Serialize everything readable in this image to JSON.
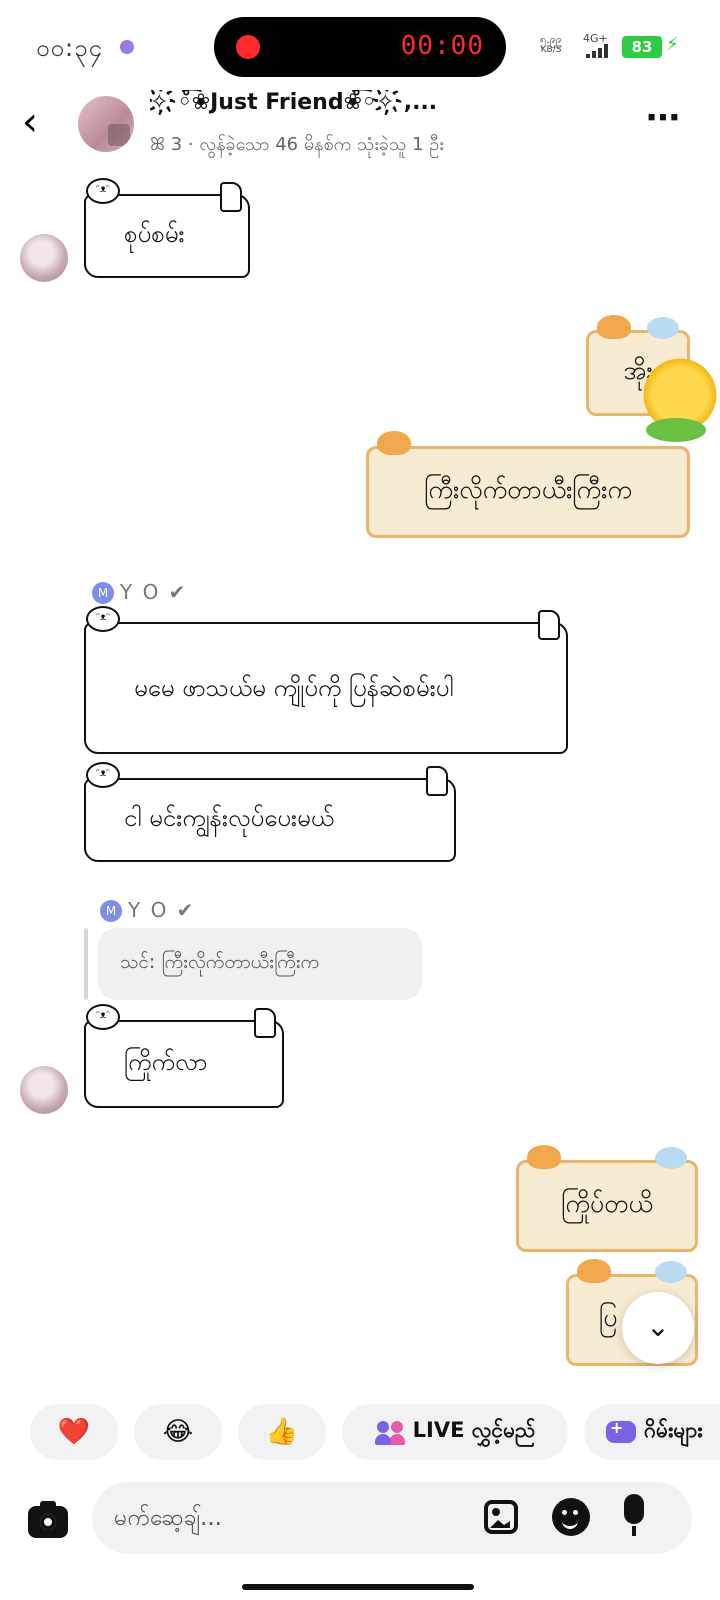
{
  "status_bar": {
    "time": "၀၀:၃၄",
    "recording_time": "00:00",
    "net_speed_value": "၅.၉၉",
    "net_speed_unit": "KB/S",
    "network": "4G+",
    "battery": "83"
  },
  "header": {
    "title": "✧҉◦̊͡❀Just Friend❀̊͡◦✧҉,...",
    "subtitle": "ꕤ 3 · လွန်ခဲ့သော 46 မိနစ်က သုံးခဲ့သူ 1 ဦး"
  },
  "messages": [
    {
      "side": "left",
      "style": "scroll",
      "text": "စုပ်စမ်း"
    },
    {
      "side": "right",
      "style": "cat",
      "text": "အိုး"
    },
    {
      "side": "right",
      "style": "cat",
      "text": "ကြီးလိုက်တာယီးကြီးက"
    },
    {
      "side": "left",
      "style": "scroll",
      "sender": "Y O ✔",
      "text": "မမေ ဖာသယ်မ ကျိုပ်ကို ပြန်ဆဲစမ်းပါ"
    },
    {
      "side": "left",
      "style": "scroll",
      "text": "ငါ မင်းကျွန်းလုပ်ပေးမယ်"
    },
    {
      "side": "left",
      "style": "scroll",
      "sender": "Y O ✔",
      "reply_to": "သင်: ကြီးလိုက်တာယီးကြီးက",
      "text": "ကြိုက်လာ"
    },
    {
      "side": "right",
      "style": "cat",
      "text": "ကြိုပ်တယိ"
    },
    {
      "side": "right",
      "style": "cat",
      "text": "ပြ"
    }
  ],
  "sender_initial": "M",
  "quick_actions": {
    "heart": "❤️",
    "laugh": "😂",
    "thumbs": "👍",
    "live_label": "LIVE လွှင့်မည်",
    "games_label": "ဂိမ်းများ"
  },
  "composer": {
    "placeholder": "မက်ဆေ့ချ်..."
  }
}
